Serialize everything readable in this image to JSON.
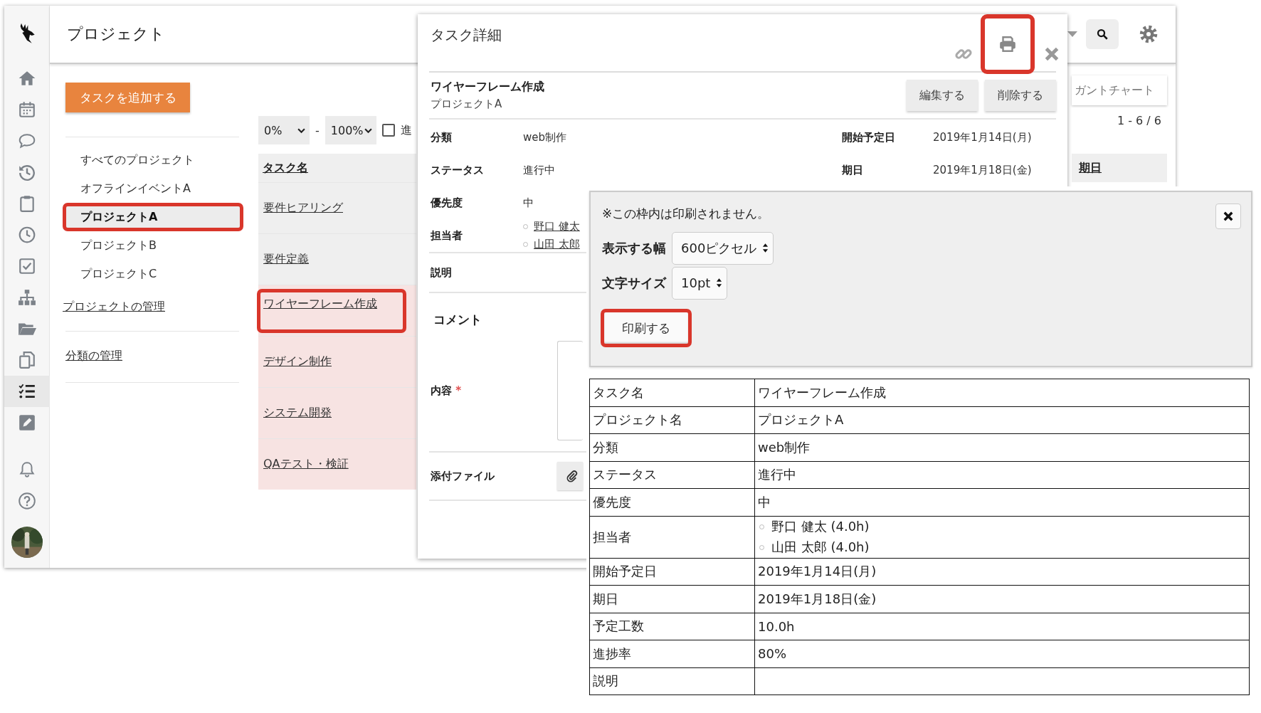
{
  "sidebar": {
    "items": [
      {
        "kind": "logo",
        "selected": false
      },
      {
        "kind": "home",
        "selected": false
      },
      {
        "kind": "calendar",
        "selected": false
      },
      {
        "kind": "chat",
        "selected": false
      },
      {
        "kind": "history",
        "selected": false
      },
      {
        "kind": "clipboard",
        "selected": false
      },
      {
        "kind": "clock",
        "selected": false
      },
      {
        "kind": "check",
        "selected": false
      },
      {
        "kind": "org",
        "selected": false
      },
      {
        "kind": "folder",
        "selected": false
      },
      {
        "kind": "copy",
        "selected": false
      },
      {
        "kind": "list",
        "selected": true
      },
      {
        "kind": "edit",
        "selected": false
      },
      {
        "kind": "bell",
        "selected": false
      },
      {
        "kind": "help",
        "selected": false
      },
      {
        "kind": "avatar",
        "selected": false
      }
    ]
  },
  "header": {
    "title": "プロジェクト",
    "tools": [
      {
        "kind": "dropdown"
      },
      {
        "kind": "search"
      },
      {
        "kind": "settings"
      }
    ]
  },
  "add_task_button": "タスクを追加する",
  "project_nav": {
    "items": [
      {
        "label": "すべてのプロジェクト",
        "selected": false,
        "highlighted": false
      },
      {
        "label": "オフラインイベントA",
        "selected": false,
        "highlighted": false
      },
      {
        "label": "プロジェクトA",
        "selected": true,
        "highlighted": true
      },
      {
        "label": "プロジェクトB",
        "selected": false,
        "highlighted": false
      },
      {
        "label": "プロジェクトC",
        "selected": false,
        "highlighted": false
      }
    ],
    "links": [
      "プロジェクトの管理",
      "分類の管理"
    ]
  },
  "filter": {
    "min": "0%",
    "separator": "-",
    "max": "100%",
    "checkbox_label": "進",
    "checked": false
  },
  "task_table": {
    "column": "タスク名",
    "rows": [
      {
        "name": "要件ヒアリング",
        "flagged": false,
        "highlighted": false
      },
      {
        "name": "要件定義",
        "flagged": false,
        "highlighted": false
      },
      {
        "name": "ワイヤーフレーム作成",
        "flagged": true,
        "highlighted": true
      },
      {
        "name": "デザイン制作",
        "flagged": true,
        "highlighted": false
      },
      {
        "name": "システム開発",
        "flagged": true,
        "highlighted": false
      },
      {
        "name": "QAテスト・検証",
        "flagged": true,
        "highlighted": false
      }
    ]
  },
  "gantt_button": "ガントチャート",
  "pagination": "1 - 6 / 6",
  "due_column": "期日",
  "task_detail": {
    "title": "タスク詳細",
    "actions": [
      {
        "kind": "link",
        "highlighted": false
      },
      {
        "kind": "print",
        "highlighted": true
      },
      {
        "kind": "close",
        "highlighted": false
      }
    ],
    "task_name": "ワイヤーフレーム作成",
    "project": "プロジェクトA",
    "buttons": [
      "編集する",
      "削除する"
    ],
    "fields": [
      {
        "label": "分類",
        "value": "web制作"
      },
      {
        "label": "ステータス",
        "value": "進行中"
      },
      {
        "label": "優先度",
        "value": "中"
      }
    ],
    "dates": [
      {
        "label": "開始予定日",
        "value": "2019年1月14日(月)"
      },
      {
        "label": "期日",
        "value": "2019年1月18日(金)"
      }
    ],
    "assignee_label": "担当者",
    "assignees": [
      "野口 健太",
      "山田 太郎"
    ],
    "description_label": "説明",
    "comment_heading": "コメント",
    "content_label": "内容",
    "required_mark": "*",
    "attachment_label": "添付ファイル"
  },
  "print_options": {
    "note": "※この枠内は印刷されません。",
    "settings": [
      {
        "label": "表示する幅",
        "value": "600ピクセル"
      },
      {
        "label": "文字サイズ",
        "value": "10pt"
      }
    ],
    "print_button": {
      "label": "印刷する",
      "highlighted": true
    },
    "preview_rows": [
      {
        "kind": "text",
        "label": "タスク名",
        "values": [
          "ワイヤーフレーム作成"
        ]
      },
      {
        "kind": "text",
        "label": "プロジェクト名",
        "values": [
          "プロジェクトA"
        ]
      },
      {
        "kind": "text",
        "label": "分類",
        "values": [
          "web制作"
        ]
      },
      {
        "kind": "text",
        "label": "ステータス",
        "values": [
          "進行中"
        ]
      },
      {
        "kind": "text",
        "label": "優先度",
        "values": [
          "中"
        ]
      },
      {
        "kind": "list",
        "label": "担当者",
        "values": [
          "野口 健太 (4.0h)",
          "山田 太郎 (4.0h)"
        ]
      },
      {
        "kind": "text",
        "label": "開始予定日",
        "values": [
          "2019年1月14日(月)"
        ]
      },
      {
        "kind": "text",
        "label": "期日",
        "values": [
          "2019年1月18日(金)"
        ]
      },
      {
        "kind": "text",
        "label": "予定工数",
        "values": [
          "10.0h"
        ]
      },
      {
        "kind": "text",
        "label": "進捗率",
        "values": [
          "80%"
        ]
      },
      {
        "kind": "text",
        "label": "説明"
      }
    ]
  }
}
